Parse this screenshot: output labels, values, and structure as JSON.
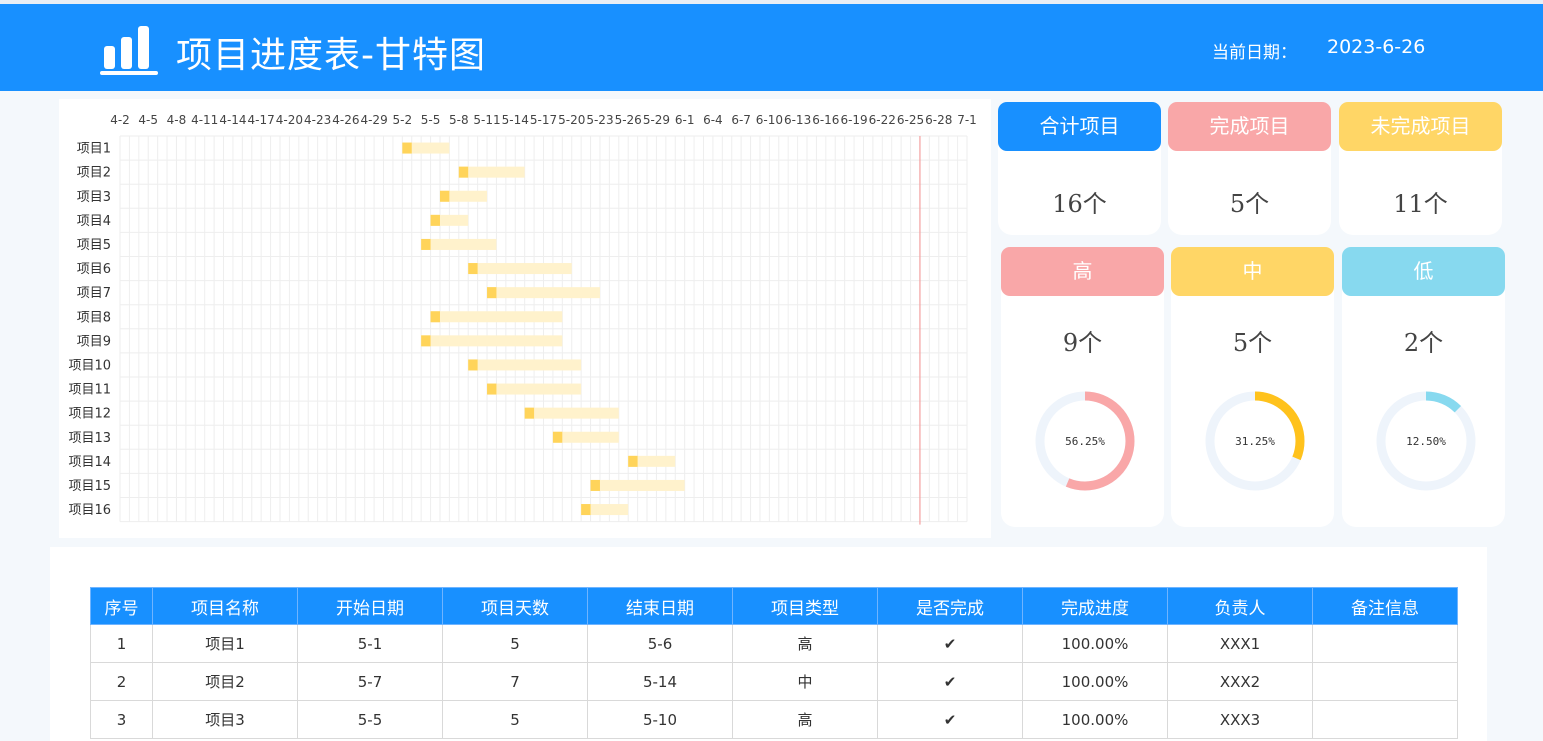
{
  "header": {
    "title": "项目进度表-甘特图",
    "date_label": "当前日期：",
    "date_value": "2023-6-26"
  },
  "chart_data": {
    "type": "bar",
    "subtype": "gantt",
    "x_tick_labels": [
      "4-2",
      "4-5",
      "4-8",
      "4-11",
      "4-14",
      "4-17",
      "4-20",
      "4-23",
      "4-26",
      "4-29",
      "5-2",
      "5-5",
      "5-8",
      "5-11",
      "5-14",
      "5-17",
      "5-20",
      "5-23",
      "5-26",
      "5-29",
      "6-1",
      "6-4",
      "6-7",
      "6-10",
      "6-13",
      "6-16",
      "6-19",
      "6-22",
      "6-25",
      "6-28",
      "7-1"
    ],
    "x_range": [
      "4-2",
      "7-1"
    ],
    "today_marker": "6-26",
    "grid": true,
    "projects": [
      {
        "name": "项目1",
        "start": "5-2",
        "progress_days": 1,
        "end": "5-7"
      },
      {
        "name": "项目2",
        "start": "5-8",
        "progress_days": 1,
        "end": "5-15"
      },
      {
        "name": "项目3",
        "start": "5-6",
        "progress_days": 1,
        "end": "5-11"
      },
      {
        "name": "项目4",
        "start": "5-5",
        "progress_days": 1,
        "end": "5-9"
      },
      {
        "name": "项目5",
        "start": "5-4",
        "progress_days": 1,
        "end": "5-12"
      },
      {
        "name": "项目6",
        "start": "5-9",
        "progress_days": 1,
        "end": "5-20"
      },
      {
        "name": "项目7",
        "start": "5-11",
        "progress_days": 1,
        "end": "5-23"
      },
      {
        "name": "项目8",
        "start": "5-5",
        "progress_days": 1,
        "end": "5-19"
      },
      {
        "name": "项目9",
        "start": "5-4",
        "progress_days": 1,
        "end": "5-19"
      },
      {
        "name": "项目10",
        "start": "5-9",
        "progress_days": 1,
        "end": "5-21"
      },
      {
        "name": "项目11",
        "start": "5-11",
        "progress_days": 1,
        "end": "5-21"
      },
      {
        "name": "项目12",
        "start": "5-15",
        "progress_days": 1,
        "end": "5-25"
      },
      {
        "name": "项目13",
        "start": "5-18",
        "progress_days": 1,
        "end": "5-25"
      },
      {
        "name": "项目14",
        "start": "5-26",
        "progress_days": 1,
        "end": "5-31"
      },
      {
        "name": "项目15",
        "start": "5-22",
        "progress_days": 1,
        "end": "6-1"
      },
      {
        "name": "项目16",
        "start": "5-21",
        "progress_days": 1,
        "end": "5-26"
      }
    ],
    "colors": {
      "done": "#ffd45a",
      "remaining": "#fff2cc",
      "today_line": "#f4a0a0"
    }
  },
  "summary_cards": [
    {
      "label": "合计项目",
      "value": "16个",
      "color": "#1890ff"
    },
    {
      "label": "完成项目",
      "value": "5个",
      "color": "#f9a7a8"
    },
    {
      "label": "未完成项目",
      "value": "11个",
      "color": "#ffd666"
    }
  ],
  "priority_cards": [
    {
      "label": "高",
      "value": "9个",
      "percent_text": "56.25%",
      "fraction": 0.5625,
      "head_color": "#f9a7a8",
      "ring_color": "#f9a7a8"
    },
    {
      "label": "中",
      "value": "5个",
      "percent_text": "31.25%",
      "fraction": 0.3125,
      "head_color": "#ffd666",
      "ring_color": "#ffc21c"
    },
    {
      "label": "低",
      "value": "2个",
      "percent_text": "12.50%",
      "fraction": 0.125,
      "head_color": "#87d9ef",
      "ring_color": "#87d9ef"
    }
  ],
  "table": {
    "headers": [
      "序号",
      "项目名称",
      "开始日期",
      "项目天数",
      "结束日期",
      "项目类型",
      "是否完成",
      "完成进度",
      "负责人",
      "备注信息"
    ],
    "rows": [
      [
        "1",
        "项目1",
        "5-1",
        "5",
        "5-6",
        "高",
        "✔",
        "100.00%",
        "XXX1",
        ""
      ],
      [
        "2",
        "项目2",
        "5-7",
        "7",
        "5-14",
        "中",
        "✔",
        "100.00%",
        "XXX2",
        ""
      ],
      [
        "3",
        "项目3",
        "5-5",
        "5",
        "5-10",
        "高",
        "✔",
        "100.00%",
        "XXX3",
        ""
      ]
    ]
  }
}
